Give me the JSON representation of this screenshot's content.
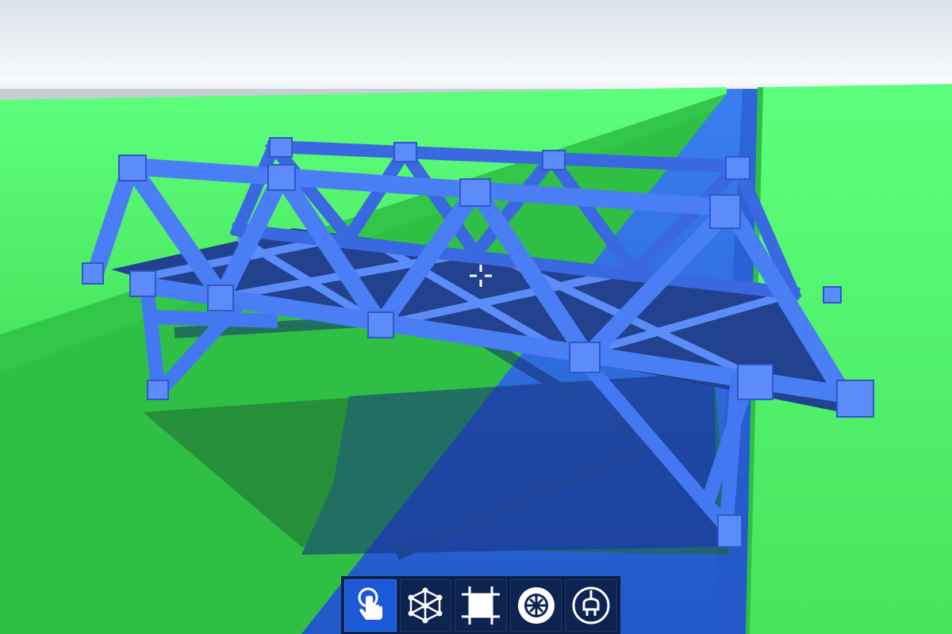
{
  "scene": {
    "sky_color": "#f3f6f9",
    "grass_color": "#44e35a",
    "river_color": "#2e6ad8",
    "bridge_color": "#3f73ef",
    "deck_color": "#1f3f9a"
  },
  "toolbar": {
    "active_tool": "select",
    "tools": [
      {
        "id": "select",
        "icon": "hand-pointer-icon"
      },
      {
        "id": "truss",
        "icon": "truss-cube-icon"
      },
      {
        "id": "road",
        "icon": "square-frame-icon"
      },
      {
        "id": "wheel",
        "icon": "wheel-icon"
      },
      {
        "id": "power",
        "icon": "plug-icon"
      }
    ]
  }
}
